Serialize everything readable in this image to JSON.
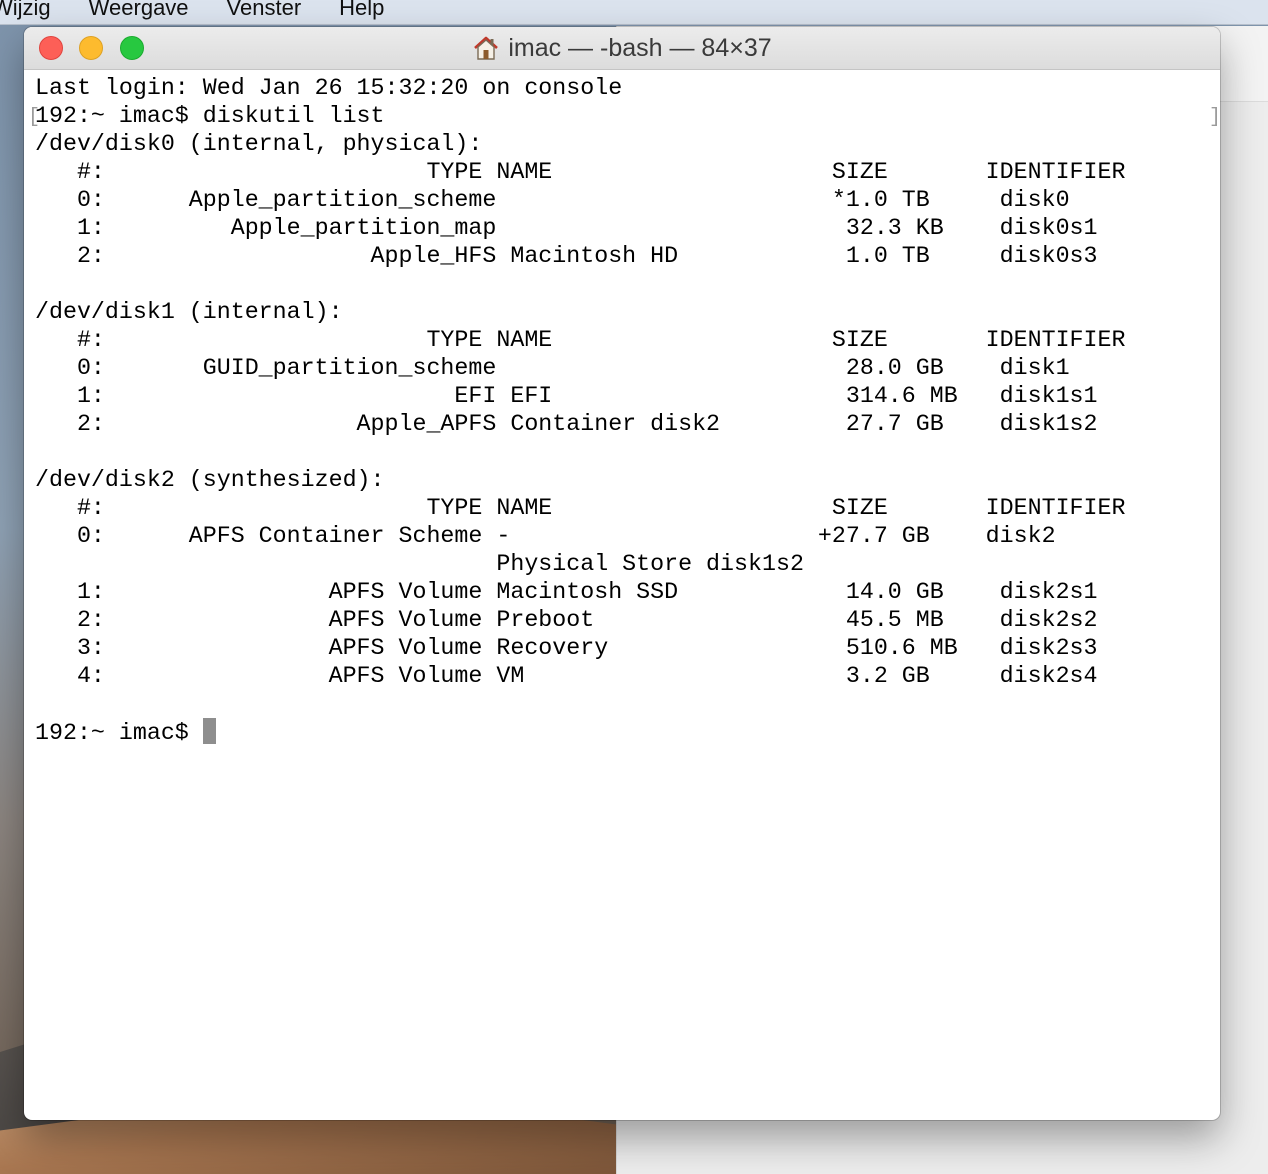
{
  "menubar": {
    "items": [
      "Wijzig",
      "Weergave",
      "Venster",
      "Help"
    ]
  },
  "window": {
    "title": "imac — -bash — 84×37",
    "icons": {
      "title_icon": "home-icon"
    },
    "traffic_lights": {
      "close": "#fd5f57",
      "minimize": "#fdbb2e",
      "maximize": "#27c840"
    }
  },
  "terminal": {
    "lines": [
      "Last login: Wed Jan 26 15:32:20 on console",
      "192:~ imac$ diskutil list",
      "/dev/disk0 (internal, physical):",
      "   #:                       TYPE NAME                    SIZE       IDENTIFIER",
      "   0:      Apple_partition_scheme                        *1.0 TB     disk0",
      "   1:         Apple_partition_map                         32.3 KB    disk0s1",
      "   2:                   Apple_HFS Macintosh HD            1.0 TB     disk0s3",
      "",
      "/dev/disk1 (internal):",
      "   #:                       TYPE NAME                    SIZE       IDENTIFIER",
      "   0:       GUID_partition_scheme                         28.0 GB    disk1",
      "   1:                         EFI EFI                     314.6 MB   disk1s1",
      "   2:                  Apple_APFS Container disk2         27.7 GB    disk1s2",
      "",
      "/dev/disk2 (synthesized):",
      "   #:                       TYPE NAME                    SIZE       IDENTIFIER",
      "   0:      APFS Container Scheme -                      +27.7 GB    disk2",
      "                                 Physical Store disk1s2",
      "   1:                APFS Volume Macintosh SSD            14.0 GB    disk2s1",
      "   2:                APFS Volume Preboot                  45.5 MB    disk2s2",
      "   3:                APFS Volume Recovery                 510.6 MB   disk2s3",
      "   4:                APFS Volume VM                       3.2 GB     disk2s4",
      ""
    ],
    "prompt": "192:~ imac$ "
  }
}
